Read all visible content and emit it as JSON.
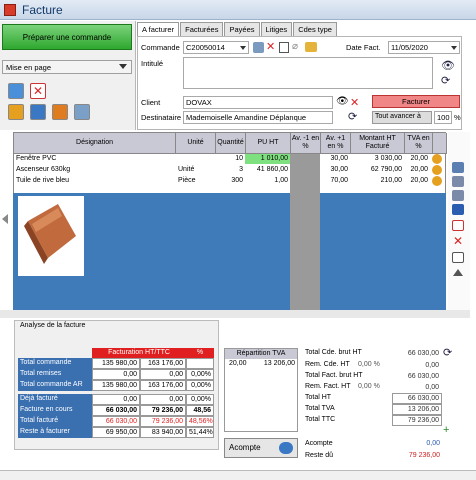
{
  "window": {
    "title": "Facture"
  },
  "left": {
    "prepare_button": "Préparer une commande",
    "layout_label": "Mise en page"
  },
  "tabs": [
    "A facturer",
    "Facturées",
    "Payées",
    "Litiges",
    "Cdes type"
  ],
  "header": {
    "commande_label": "Commande",
    "commande_value": "C20050014",
    "date_label": "Date Fact.",
    "date_value": "11/05/2020",
    "intitule_label": "Intitulé",
    "client_label": "Client",
    "client_value": "DOVAX",
    "destinataire_label": "Destinataire",
    "destinataire_value": "Mademoiselle Amandine Déplanque",
    "facturer_button": "Facturer",
    "advance_label": "Tout avancer à",
    "advance_value": "100",
    "advance_unit": "%"
  },
  "grid": {
    "columns": [
      "Désignation",
      "Unité",
      "Quantité",
      "PU HT",
      "Av. -1 en %",
      "Av. +1 en %",
      "Montant HT Facturé",
      "TVA en %"
    ],
    "rows": [
      {
        "designation": "Fenêtre PVC",
        "unite": "",
        "quantite": "10",
        "pu_ht": "1 010,00",
        "av_m1": "",
        "av_p1": "30,00",
        "montant": "3 030,00",
        "tva": "20,00"
      },
      {
        "designation": "Ascenseur 630kg",
        "unite": "Unité",
        "quantite": "3",
        "pu_ht": "41 860,00",
        "av_m1": "",
        "av_p1": "30,00",
        "montant": "62 790,00",
        "tva": "20,00"
      },
      {
        "designation": "Tuile de rive bleu",
        "unite": "Pièce",
        "quantite": "300",
        "pu_ht": "1,00",
        "av_m1": "",
        "av_p1": "70,00",
        "montant": "210,00",
        "tva": "20,00"
      }
    ]
  },
  "analysis": {
    "title": "Analyse de la facture",
    "header_main": "Facturation HT/TTC",
    "header_pct": "%",
    "rows": [
      {
        "label": "Total commande",
        "ht": "135 980,00",
        "ttc": "163 176,00",
        "pct": ""
      },
      {
        "label": "Total remises",
        "ht": "0,00",
        "ttc": "0,00",
        "pct": "0,00%"
      },
      {
        "label": "Total commande AR",
        "ht": "135 980,00",
        "ttc": "163 176,00",
        "pct": "0,00%"
      },
      {
        "label": "Déjà facturé",
        "ht": "0,00",
        "ttc": "0,00",
        "pct": "0,00%"
      },
      {
        "label": "Facture en cours",
        "ht": "66 030,00",
        "ttc": "79 236,00",
        "pct": "48,56"
      },
      {
        "label": "Total facturé",
        "ht": "66 030,00",
        "ttc": "79 236,00",
        "pct": "48,56%"
      },
      {
        "label": "Reste à facturer",
        "ht": "69 950,00",
        "ttc": "83 940,00",
        "pct": "51,44%"
      }
    ]
  },
  "repartition": {
    "title": "Répartition TVA",
    "rate": "20,00",
    "amount": "13 206,00"
  },
  "totals": {
    "rows": [
      {
        "label": "Total Cde. brut HT",
        "value": "66 030,00",
        "pct": ""
      },
      {
        "label": "Rem. Cde. HT",
        "value": "0,00",
        "pct": "0,00 %"
      },
      {
        "label": "Total Fact. brut HT",
        "value": "66 030,00",
        "pct": ""
      },
      {
        "label": "Rem. Fact. HT",
        "value": "0,00",
        "pct": "0,00 %"
      },
      {
        "label": "Total HT",
        "value": "66 030,00",
        "pct": ""
      },
      {
        "label": "Total TVA",
        "value": "13 206,00",
        "pct": ""
      },
      {
        "label": "Total TTC",
        "value": "79 236,00",
        "pct": ""
      }
    ],
    "acompte_label": "Acompte",
    "acompte_value": "0,00",
    "reste_label": "Reste dû",
    "reste_value": "79 236,00"
  },
  "acompte_button": "Acompte",
  "colors": {
    "accent_red": "#e02020",
    "blue": "#3e7bb8",
    "green": "#2ea82e"
  }
}
